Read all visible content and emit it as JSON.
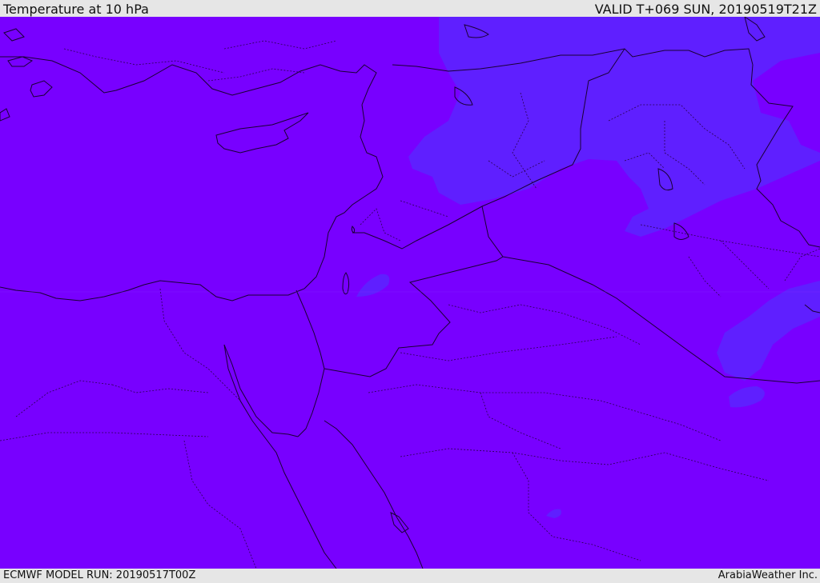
{
  "header": {
    "title": "Temperature at 10 hPa",
    "valid": "VALID T+069 SUN, 20190519T21Z"
  },
  "footer": {
    "model_run": "ECMWF MODEL RUN: 20190517T00Z",
    "credit": "ArabiaWeather Inc."
  },
  "map": {
    "colors": {
      "base_field": "#7800ff",
      "warm_field": "#5f1fff",
      "coastline": "#1a0033",
      "border": "#1a0033"
    }
  }
}
